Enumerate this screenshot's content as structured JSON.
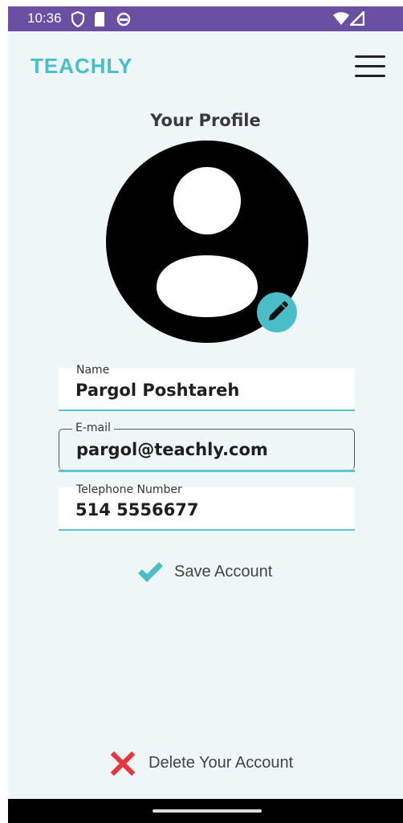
{
  "status_bar": {
    "time": "10:36",
    "icons": [
      "shield-icon",
      "sd-card-icon",
      "circle-icon",
      "wifi-icon",
      "signal-icon"
    ]
  },
  "app_bar": {
    "logo": "TEACHLY",
    "menu_icon": "hamburger-menu-icon"
  },
  "profile": {
    "title": "Your Profile",
    "avatar_icon": "person-icon",
    "edit_icon": "pencil-icon"
  },
  "fields": {
    "name": {
      "label": "Name",
      "value": "Pargol Poshtareh"
    },
    "email": {
      "label": "E-mail",
      "value": "pargol@teachly.com"
    },
    "phone": {
      "label": "Telephone Number",
      "value": "514 5556677"
    }
  },
  "actions": {
    "save_label": "Save Account",
    "save_icon": "checkmark-icon",
    "delete_label": "Delete Your Account",
    "delete_icon": "close-x-icon"
  },
  "colors": {
    "accent": "#46bfcb",
    "status_bar": "#6a4fa3",
    "background": "#eef6f7",
    "delete": "#e8343b"
  }
}
